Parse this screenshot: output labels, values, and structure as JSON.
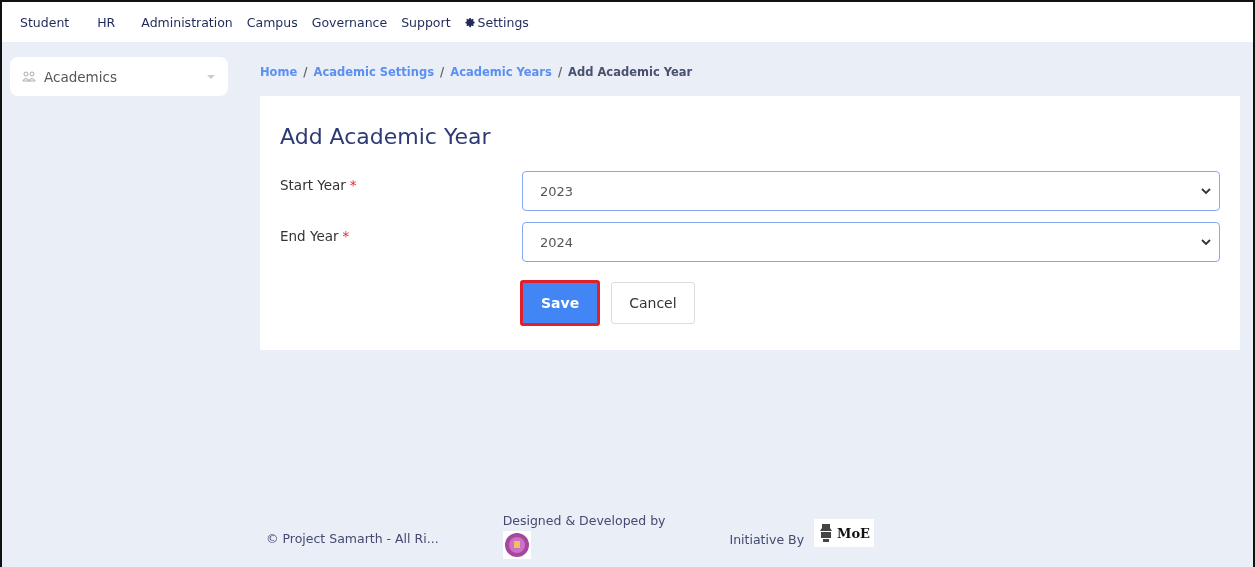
{
  "top_nav": [
    {
      "label": "Student",
      "icon": false
    },
    {
      "label": "HR",
      "icon": false
    },
    {
      "label": "Administration",
      "icon": false
    },
    {
      "label": "Campus",
      "icon": false
    },
    {
      "label": "Governance",
      "icon": false
    },
    {
      "label": "Support",
      "icon": false
    },
    {
      "label": "Settings",
      "icon": true
    }
  ],
  "sidebar": {
    "items": [
      {
        "label": "Academics",
        "expanded": false
      }
    ]
  },
  "breadcrumb": [
    {
      "label": "Home",
      "kind": "link"
    },
    {
      "label": "Academic Settings",
      "kind": "link"
    },
    {
      "label": "Academic Years",
      "kind": "link"
    },
    {
      "label": "Add Academic Year",
      "kind": "current"
    }
  ],
  "breadcrumb_separator": "/",
  "form": {
    "title": "Add Academic Year",
    "fields": [
      {
        "label": "Start Year",
        "required_mark": "*",
        "value": "2023"
      },
      {
        "label": "End Year",
        "required_mark": "*",
        "value": "2024"
      }
    ],
    "buttons": [
      {
        "label": "Save",
        "kind": "primary",
        "highlighted": true
      },
      {
        "label": "Cancel",
        "kind": "secondary",
        "highlighted": false
      }
    ]
  },
  "footer": {
    "copyright": "© Project Samarth - All Ri...",
    "designed_by": "Designed & Developed by",
    "initiative": "Initiative By",
    "logo_text": "MoE"
  }
}
